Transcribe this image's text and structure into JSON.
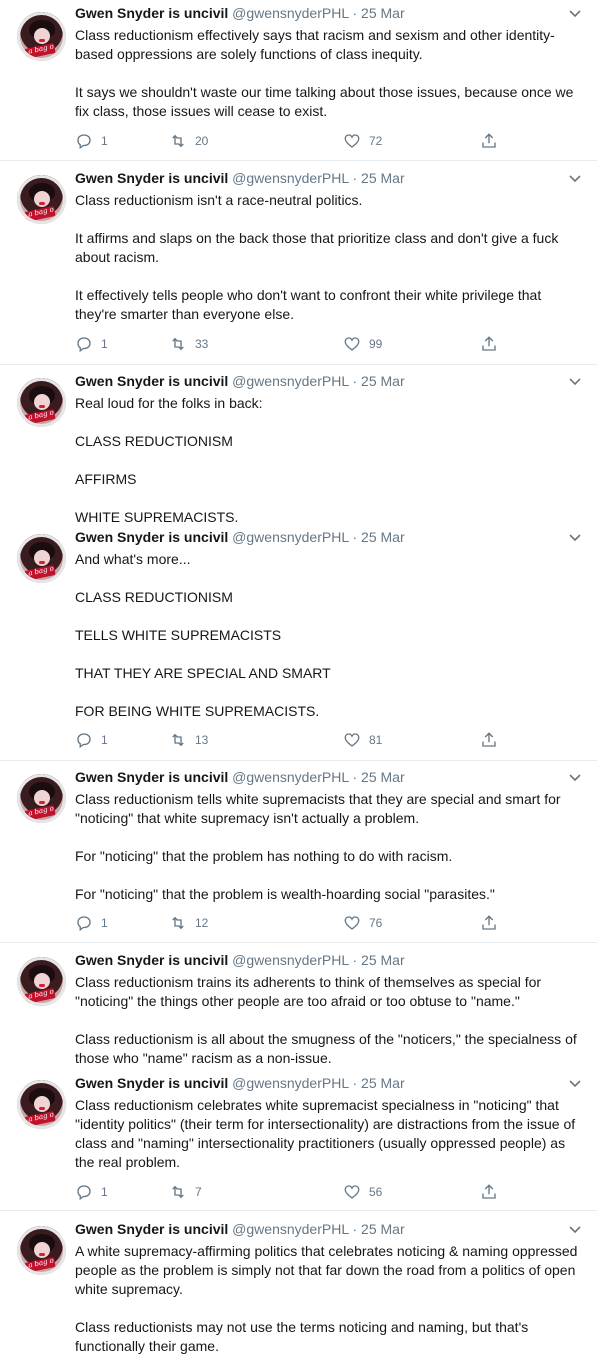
{
  "author": {
    "name": "Gwen Snyder is uncivil",
    "handle": "@gwensnyderPHL",
    "avatar_tag": "a bag o"
  },
  "tweets": [
    {
      "date": "25 Mar",
      "paragraphs": [
        "Class reductionism effectively says that racism and sexism and other identity-based oppressions are solely functions of class inequity.",
        "It says we shouldn't waste our time talking about those issues, because once we fix class, those issues will cease to exist."
      ],
      "replies": "1",
      "retweets": "20",
      "likes": "72"
    },
    {
      "date": "25 Mar",
      "paragraphs": [
        "Class reductionism isn't a race-neutral politics.",
        "It affirms and slaps on the back those that prioritize class and don't give a fuck about racism.",
        "It effectively tells people who don't want to confront their white privilege that they're smarter than everyone else."
      ],
      "replies": "1",
      "retweets": "33",
      "likes": "99"
    },
    {
      "date": "25 Mar",
      "paragraphs": [
        "Real loud for the folks in back:",
        "CLASS REDUCTIONISM",
        "AFFIRMS",
        "WHITE SUPREMACISTS."
      ]
    },
    {
      "date": "25 Mar",
      "paragraphs": [
        "And what's more...",
        "CLASS REDUCTIONISM",
        "TELLS WHITE SUPREMACISTS",
        "THAT THEY ARE SPECIAL AND SMART",
        "FOR BEING WHITE SUPREMACISTS."
      ],
      "replies": "1",
      "retweets": "13",
      "likes": "81"
    },
    {
      "date": "25 Mar",
      "paragraphs": [
        "Class reductionism tells white supremacists that they are special and smart for \"noticing\" that white supremacy isn't actually a problem.",
        "For \"noticing\" that the problem has nothing to do with racism.",
        "For \"noticing\" that the problem is wealth-hoarding social \"parasites.\""
      ],
      "replies": "1",
      "retweets": "12",
      "likes": "76"
    },
    {
      "date": "25 Mar",
      "paragraphs": [
        "Class reductionism trains its adherents to think of themselves as special for \"noticing\" the things other people are too afraid or too obtuse to \"name.\"",
        "Class reductionism is all about the smugness of the \"noticers,\" the specialness of those who \"name\" racism as a non-issue."
      ]
    },
    {
      "date": "25 Mar",
      "paragraphs": [
        "Class reductionism celebrates white supremacist specialness in \"noticing\" that \"identity politics\" (their term for intersectionality) are distractions from the issue of class and \"naming\" intersectionality practitioners (usually oppressed people) as the real problem."
      ],
      "replies": "1",
      "retweets": "7",
      "likes": "56"
    },
    {
      "date": "25 Mar",
      "paragraphs": [
        "A white supremacy-affirming politics that celebrates noticing & naming oppressed people as the problem is simply not that far down the road from a politics of open white supremacy.",
        "Class reductionists may not use the terms noticing and naming, but that's functionally their game."
      ]
    }
  ],
  "icons": {
    "reply": "reply-icon",
    "retweet": "retweet-icon",
    "like": "heart-icon",
    "share": "share-icon",
    "more": "chevron-down-icon"
  },
  "colors": {
    "meta": "#657786",
    "text": "#14171a",
    "divider": "#e6ecf0"
  }
}
